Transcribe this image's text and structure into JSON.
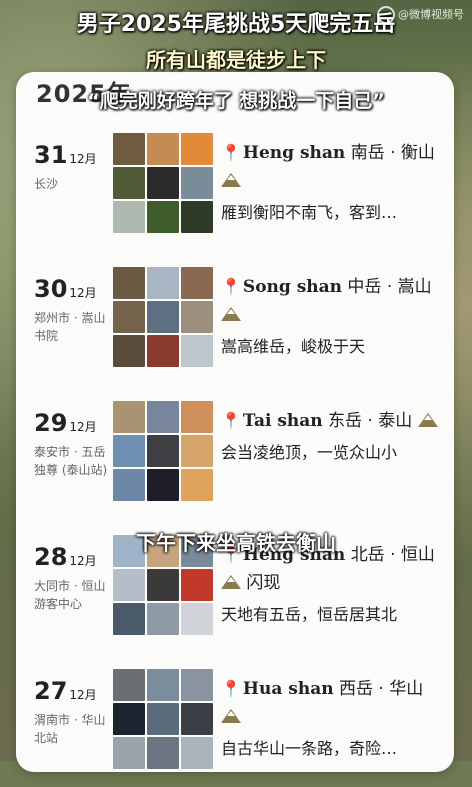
{
  "headline": {
    "line1": "男子2025年尾挑战5天爬完五岳",
    "line2": "所有山都是徒步上下",
    "line3": "“爬完刚好跨年了 想挑战一下自己”"
  },
  "watermark": "@微博视频号",
  "year_heading": "2025年",
  "subtitle": "下午下来坐高铁去衡山",
  "entries": [
    {
      "day": "31",
      "month": "12月",
      "location": "长沙",
      "name_en": "Heng shan",
      "name_cn": "南岳 · 衡山",
      "quote": "雁到衡阳不南飞，客到…",
      "photo_colors": [
        "#6f5b3f",
        "#c48b52",
        "#e08a3a",
        "#4f5b36",
        "#2a2a2a",
        "#7a8c97",
        "#aeb9b1",
        "#3f5e2c",
        "#2e3b27"
      ]
    },
    {
      "day": "30",
      "month": "12月",
      "location": "郑州市 · 嵩山书院",
      "name_en": "Song shan",
      "name_cn": "中岳 · 嵩山",
      "quote": "嵩高维岳，峻极于天",
      "photo_colors": [
        "#6a5a44",
        "#aab5c3",
        "#886952",
        "#75624a",
        "#5f6f82",
        "#9c8f7e",
        "#5a4c3a",
        "#8b3a2f",
        "#bfc5cc"
      ]
    },
    {
      "day": "29",
      "month": "12月",
      "location": "泰安市 · 五岳独尊 (泰山站)",
      "name_en": "Tai shan",
      "name_cn": "东岳 · 泰山",
      "quote": "会当凌绝顶，一览众山小",
      "photo_colors": [
        "#a89470",
        "#78859a",
        "#cf8f5a",
        "#6e8fb0",
        "#3e3f42",
        "#d6a56a",
        "#6c87a8",
        "#1e1e28",
        "#e0a35e"
      ]
    },
    {
      "day": "28",
      "month": "12月",
      "location": "大同市 · 恒山游客中心",
      "name_en": "Heng shan",
      "name_cn": "北岳 · 恒山",
      "quote": "天地有五岳，恒岳居其北",
      "extra": "闪现",
      "photo_colors": [
        "#9fb4c8",
        "#c7a47e",
        "#7a8a99",
        "#b5bec8",
        "#3c3a38",
        "#c0392b",
        "#4a5a6a",
        "#8e9aa5",
        "#d0d4d8"
      ]
    },
    {
      "day": "27",
      "month": "12月",
      "location": "渭南市 · 华山北站",
      "name_en": "Hua shan",
      "name_cn": "西岳 · 华山",
      "quote": "自古华山一条路，奇险…",
      "photo_colors": [
        "#6a6f73",
        "#7b8c9c",
        "#8a93a0",
        "#1c2430",
        "#5a6b7c",
        "#3a3f45",
        "#9aa3ab",
        "#6b7480",
        "#aab3bb"
      ]
    }
  ]
}
